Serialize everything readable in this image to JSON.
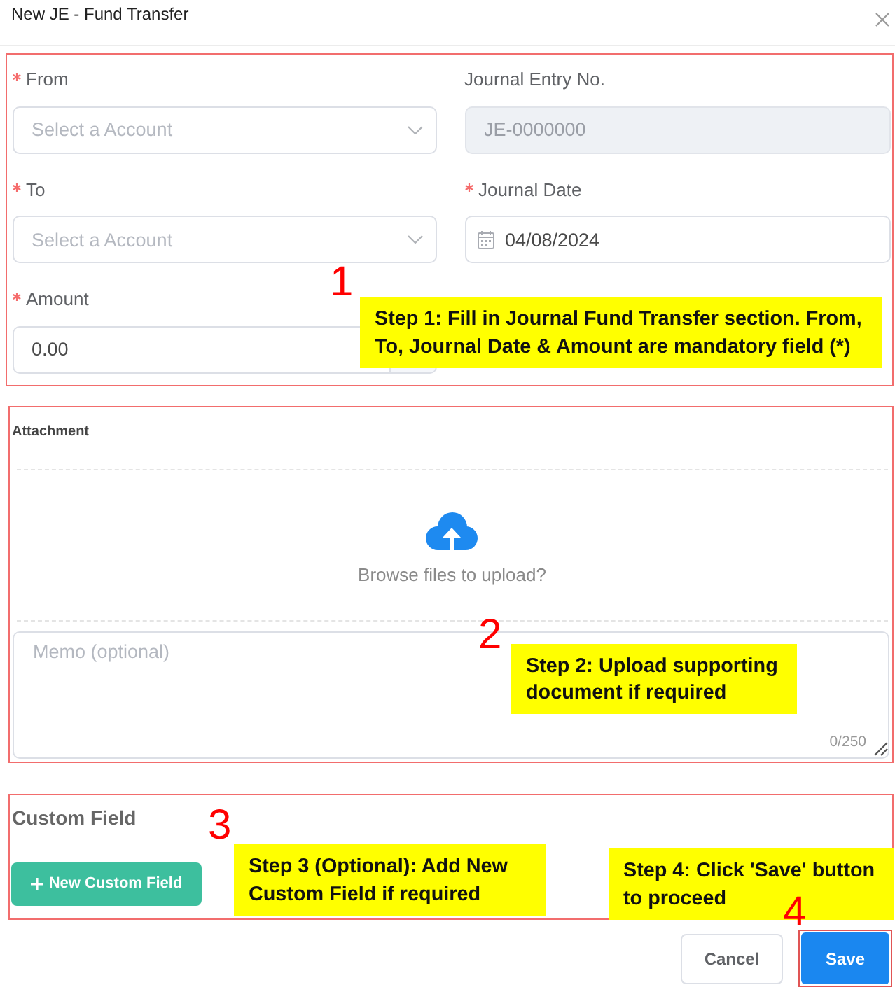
{
  "dialog": {
    "title": "New JE - Fund Transfer"
  },
  "form": {
    "highlighted": true,
    "fields": [
      {
        "label": "From",
        "required": true,
        "kind": "select",
        "placeholder": "Select a Account",
        "disabled": false
      },
      {
        "label": "Journal Entry No.",
        "required": false,
        "kind": "text",
        "placeholder": "JE-0000000",
        "disabled": true
      },
      {
        "label": "To",
        "required": true,
        "kind": "select",
        "placeholder": "Select a Account",
        "disabled": false
      },
      {
        "label": "Journal Date",
        "required": true,
        "kind": "date",
        "value": "04/08/2024",
        "disabled": false
      },
      {
        "label": "Amount",
        "required": true,
        "kind": "number",
        "value": "0.00",
        "disabled": false
      }
    ],
    "annotation": {
      "number": "1",
      "note": "Step 1: Fill in Journal Fund Transfer section. From, To, Journal Date & Amount are mandatory field (*)"
    }
  },
  "attachment": {
    "highlighted": true,
    "title": "Attachment",
    "upload_prompt": "Browse files to upload?",
    "memo": {
      "placeholder": "Memo (optional)",
      "counter": "0/250"
    },
    "annotation": {
      "number": "2",
      "note": "Step 2: Upload supporting document if required"
    }
  },
  "custom_field": {
    "highlighted": true,
    "title": "Custom Field",
    "button": "New Custom Field",
    "annotation": {
      "number": "3",
      "note": "Step 3 (Optional): Add New Custom Field if required"
    }
  },
  "footer": {
    "buttons": [
      {
        "label": "Cancel",
        "kind": "secondary",
        "highlighted": false
      },
      {
        "label": "Save",
        "kind": "primary",
        "highlighted": true
      }
    ],
    "annotation": {
      "number": "4",
      "note": "Step 4: Click 'Save' button to proceed"
    }
  }
}
